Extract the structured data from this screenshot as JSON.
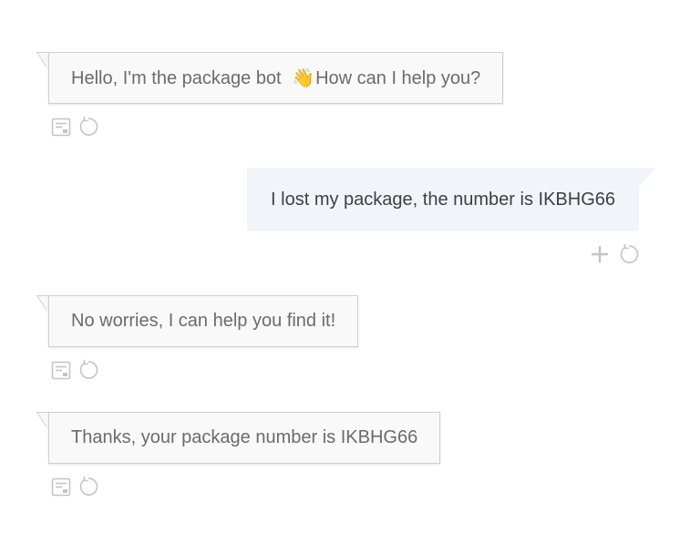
{
  "messages": [
    {
      "sender": "bot",
      "text_before_emoji": "Hello, I'm the package bot ",
      "emoji": "👋",
      "text_after_emoji": "How can I help you?",
      "actions": [
        "document-icon",
        "refresh-icon"
      ]
    },
    {
      "sender": "user",
      "text": "I lost my package, the number is IKBHG66",
      "actions": [
        "plus-icon",
        "refresh-icon"
      ]
    },
    {
      "sender": "bot",
      "text": "No worries, I can help you find it!",
      "actions": [
        "document-icon",
        "refresh-icon"
      ]
    },
    {
      "sender": "bot",
      "text": "Thanks, your package number is IKBHG66",
      "actions": [
        "document-icon",
        "refresh-icon"
      ]
    }
  ],
  "colors": {
    "bot_bubble_bg": "#f9f9f9",
    "bot_bubble_border": "#cfcfcf",
    "bot_text": "#6b6b6b",
    "user_bubble_bg": "#f1f5fa",
    "user_text": "#3f3f3f",
    "icon": "#c4c4c4"
  }
}
